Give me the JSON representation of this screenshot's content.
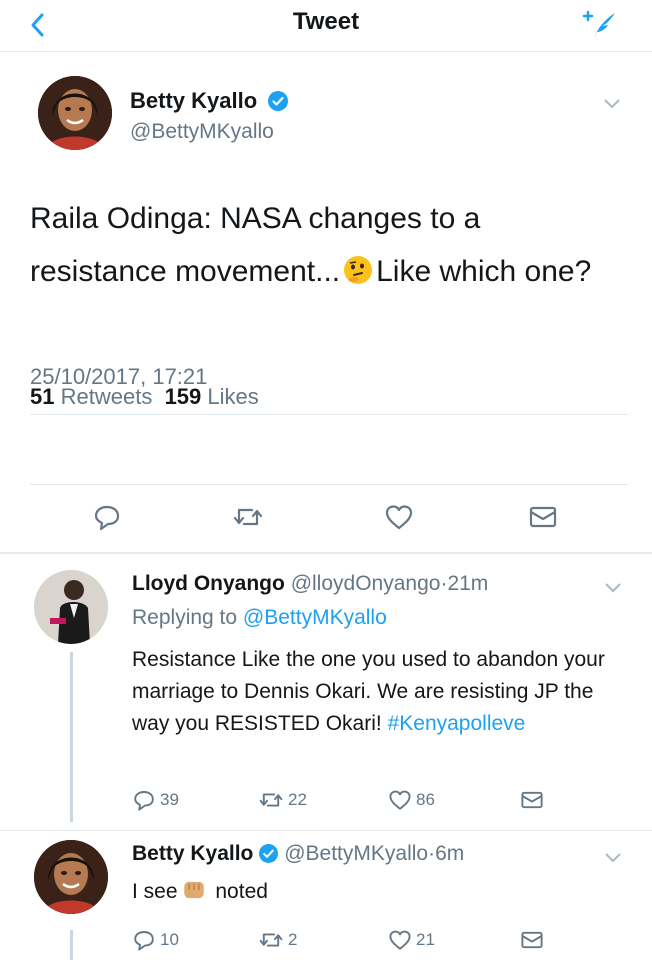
{
  "header": {
    "title": "Tweet",
    "back_icon": "chevron-left-icon",
    "compose_icon": "compose-tweet-icon",
    "accent": "#1da1f2"
  },
  "main_tweet": {
    "name": "Betty Kyallo",
    "handle": "@BettyMKyallo",
    "text_part1": "Raila Odinga: NASA changes to a resistance movement...",
    "emoji": "thinking-face-emoji",
    "text_part2": "Like which one?",
    "timestamp": "25/10/2017, 17:21",
    "retweets_count": "51",
    "retweets_label": "Retweets",
    "likes_count": "159",
    "likes_label": "Likes"
  },
  "replies": [
    {
      "name": "Lloyd Onyango",
      "handle": "@lloydOnyango",
      "sep": "·",
      "time": "21m",
      "replying_label": "Replying to",
      "replying_handle": "@BettyMKyallo",
      "text": "Resistance Like the one you used to abandon your marriage to Dennis Okari. We are resisting JP the way you RESISTED Okari!",
      "hashtag": "#Kenyapolleve",
      "reply_count": "39",
      "retweet_count": "22",
      "like_count": "86"
    },
    {
      "name": "Betty Kyallo",
      "handle": "@BettyMKyallo",
      "sep": "·",
      "time": "6m",
      "text_part1": "I see",
      "emoji": "fist-emoji",
      "text_part2": "noted",
      "reply_count": "10",
      "retweet_count": "2",
      "like_count": "21"
    }
  ]
}
